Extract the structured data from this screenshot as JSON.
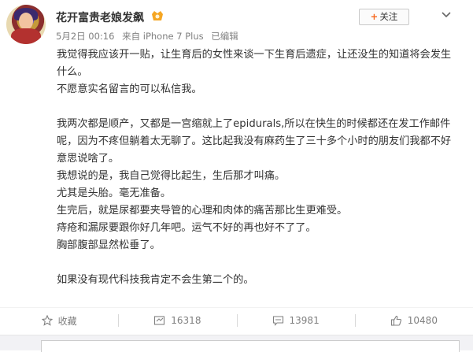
{
  "post": {
    "author": "花开富贵老娘发飙",
    "date": "5月2日 00:16",
    "source": "来自 iPhone 7 Plus",
    "edited": "已编辑",
    "follow_label": "关注",
    "paragraphs": [
      "我觉得我应该开一贴，让生育后的女性来谈一下生育后遗症，让还没生的知道将会发生什么。",
      "不愿意实名留言的可以私信我。",
      "",
      "我两次都是顺产，又都是一宫缩就上了epidurals,所以在快生的时候都还在发工作邮件呢，因为不疼但躺着太无聊了。这比起我没有麻药生了三十多个小时的朋友们我都不好意思说啥了。",
      "我想说的是，我自己觉得比起生，生后那才叫痛。",
      "尤其是头胎。毫无准备。",
      "生完后，就是尿都要夹导管的心理和肉体的痛苦那比生更难受。",
      "痔疮和漏尿要跟你好几年吧。运气不好的再也好不了了。",
      "胸部腹部显然松垂了。",
      "",
      "如果没有现代科技我肯定不会生第二个的。"
    ]
  },
  "actions": {
    "favorite_label": "收藏",
    "repost_count": "16318",
    "comment_count": "13981",
    "like_count": "10480"
  },
  "icons": {
    "favorite": "star-icon",
    "repost": "repost-icon",
    "comment": "comment-icon",
    "like": "thumbs-up-icon",
    "more": "chevron-down-icon",
    "badge": "vip-badge-icon"
  },
  "colors": {
    "accent": "#f7671d",
    "meta_text": "#808080"
  }
}
